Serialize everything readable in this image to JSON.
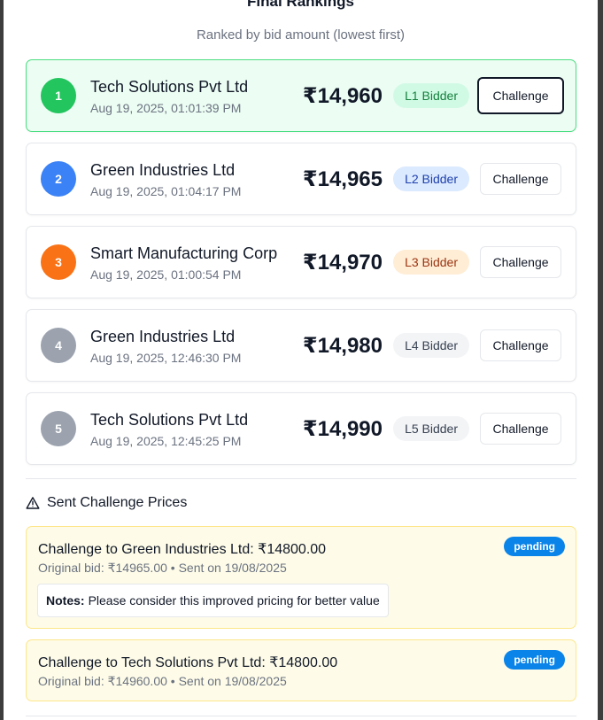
{
  "modal": {
    "title": "Final Rankings",
    "subtitle": "Ranked by bid amount (lowest first)"
  },
  "rankings": [
    {
      "rank": "1",
      "name": "Tech Solutions Pvt Ltd",
      "time": "Aug 19, 2025, 01:01:39 PM",
      "amount": "₹14,960",
      "badge": "L1 Bidder",
      "action": "Challenge"
    },
    {
      "rank": "2",
      "name": "Green Industries Ltd",
      "time": "Aug 19, 2025, 01:04:17 PM",
      "amount": "₹14,965",
      "badge": "L2 Bidder",
      "action": "Challenge"
    },
    {
      "rank": "3",
      "name": "Smart Manufacturing Corp",
      "time": "Aug 19, 2025, 01:00:54 PM",
      "amount": "₹14,970",
      "badge": "L3 Bidder",
      "action": "Challenge"
    },
    {
      "rank": "4",
      "name": "Green Industries Ltd",
      "time": "Aug 19, 2025, 12:46:30 PM",
      "amount": "₹14,980",
      "badge": "L4 Bidder",
      "action": "Challenge"
    },
    {
      "rank": "5",
      "name": "Tech Solutions Pvt Ltd",
      "time": "Aug 19, 2025, 12:45:25 PM",
      "amount": "₹14,990",
      "badge": "L5 Bidder",
      "action": "Challenge"
    }
  ],
  "colors": {
    "rank1": "#22c55e",
    "rank2": "#3b82f6",
    "rank3": "#f97316",
    "rank_other": "#9ca3af",
    "pending": "#0a84e8"
  },
  "challenges_section": {
    "icon": "warning-triangle-icon",
    "heading": "Sent Challenge Prices",
    "items": [
      {
        "title": "Challenge to Green Industries Ltd: ₹14800.00",
        "subtitle": "Original bid: ₹14965.00 • Sent on 19/08/2025",
        "status": "pending",
        "notes_label": "Notes:",
        "notes_text": "Please consider this improved pricing for better value"
      },
      {
        "title": "Challenge to Tech Solutions Pvt Ltd: ₹14800.00",
        "subtitle": "Original bid: ₹14960.00 • Sent on 19/08/2025",
        "status": "pending"
      }
    ]
  }
}
